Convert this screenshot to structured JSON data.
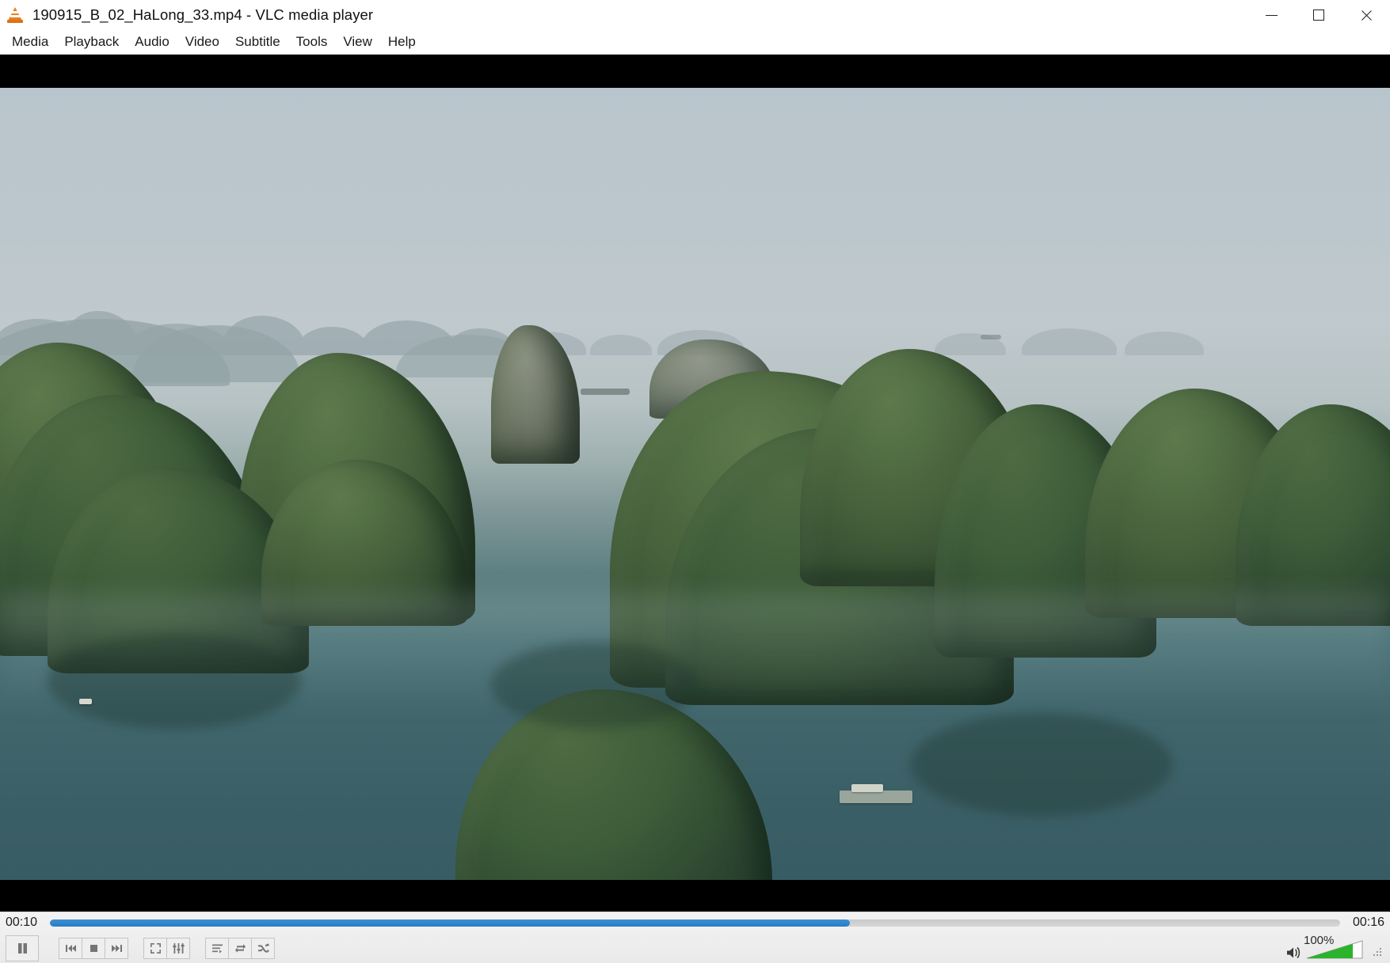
{
  "window": {
    "title": "190915_B_02_HaLong_33.mp4 - VLC media player",
    "app_icon": "vlc-cone-icon",
    "controls": {
      "minimize": "minimize-icon",
      "maximize": "maximize-icon",
      "close": "close-icon"
    }
  },
  "menubar": {
    "items": [
      {
        "label": "Media"
      },
      {
        "label": "Playback"
      },
      {
        "label": "Audio"
      },
      {
        "label": "Video"
      },
      {
        "label": "Subtitle"
      },
      {
        "label": "Tools"
      },
      {
        "label": "View"
      },
      {
        "label": "Help"
      }
    ]
  },
  "video": {
    "scene": "Aerial view of Ha Long Bay limestone karst islands in hazy light with boats on teal water",
    "letterboxed": true,
    "colors": {
      "sky": "#bcc7cd",
      "water": "#3d6268",
      "foliage": "#3d5c38",
      "limestone": "#717a6a",
      "letterbox": "#000000"
    }
  },
  "playback": {
    "elapsed": "00:10",
    "total": "00:16",
    "progress_percent": 62,
    "state": "playing",
    "seek_accent": "#2a7ec4"
  },
  "controls": {
    "buttons": [
      {
        "name": "play-pause-button",
        "icon": "pause-icon",
        "label": "Pause"
      },
      {
        "name": "previous-button",
        "icon": "previous-icon",
        "label": "Previous"
      },
      {
        "name": "stop-button",
        "icon": "stop-icon",
        "label": "Stop"
      },
      {
        "name": "next-button",
        "icon": "next-icon",
        "label": "Next"
      },
      {
        "name": "fullscreen-button",
        "icon": "fullscreen-icon",
        "label": "Toggle fullscreen"
      },
      {
        "name": "extended-settings-button",
        "icon": "equalizer-icon",
        "label": "Show extended settings"
      },
      {
        "name": "playlist-button",
        "icon": "playlist-icon",
        "label": "Show playlist"
      },
      {
        "name": "loop-button",
        "icon": "loop-icon",
        "label": "Loop"
      },
      {
        "name": "shuffle-button",
        "icon": "shuffle-icon",
        "label": "Random"
      }
    ]
  },
  "volume": {
    "level_label": "100%",
    "level_percent": 100,
    "muted": false,
    "icon": "speaker-icon",
    "slider_color": "#2cb32c"
  },
  "statusbar": {
    "resize_grip": "resize-grip-icon"
  }
}
